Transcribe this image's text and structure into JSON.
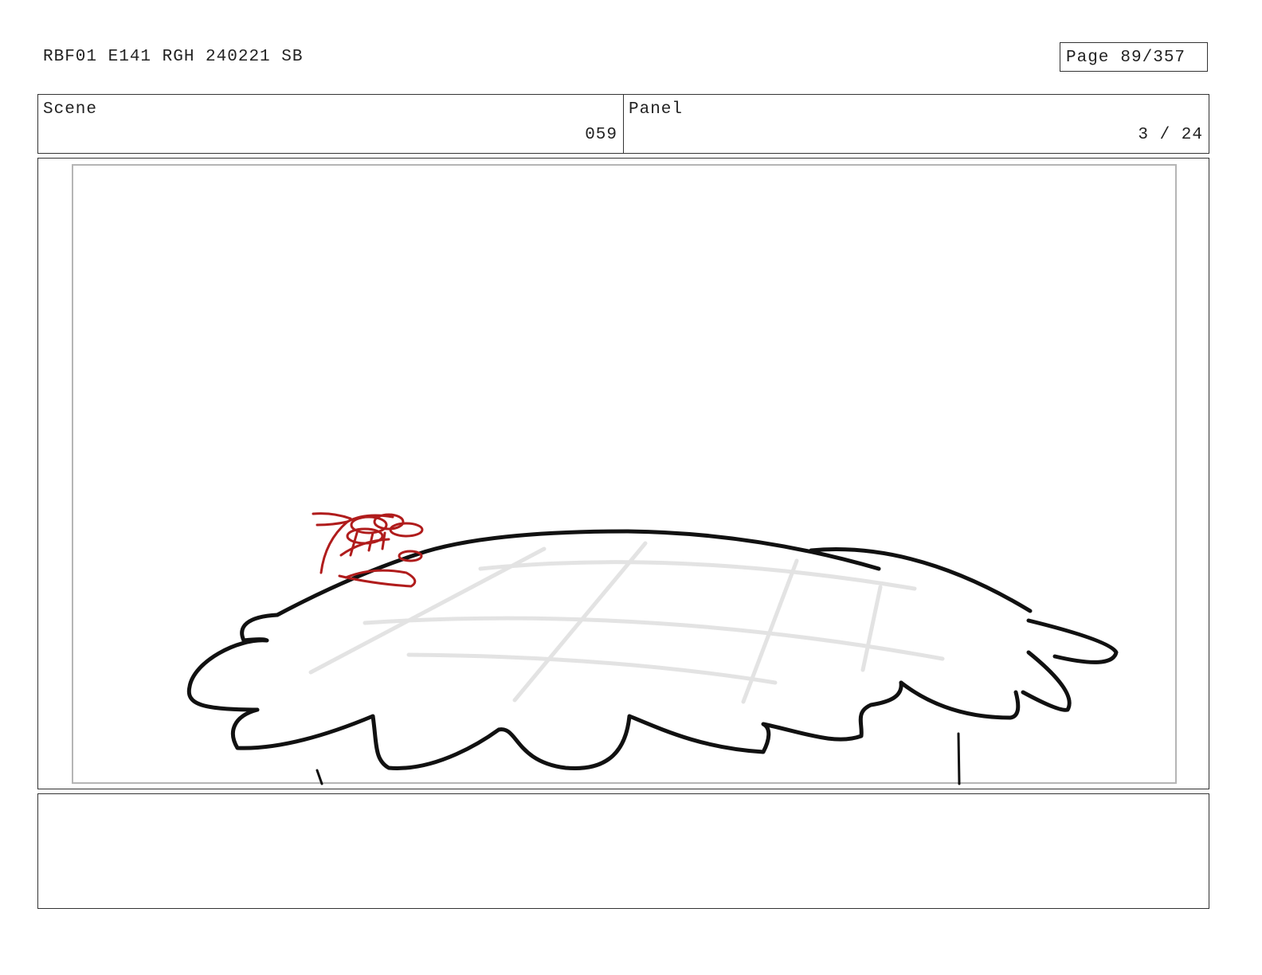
{
  "header": {
    "document_id": "RBF01 E141 RGH 240221 SB",
    "page_label": "Page",
    "page_value": "89/357"
  },
  "info": {
    "scene_label": "Scene",
    "scene_value": "059",
    "panel_label": "Panel",
    "panel_value": "3 / 24"
  },
  "panel": {
    "drawing_subject": "rough-sketch-cloud",
    "ink_color": "#111111",
    "guide_color": "#e3e3e3",
    "accent_color": "#b01c1c",
    "safe_area_color": "#b5b5b5"
  },
  "notes": {
    "text": ""
  }
}
